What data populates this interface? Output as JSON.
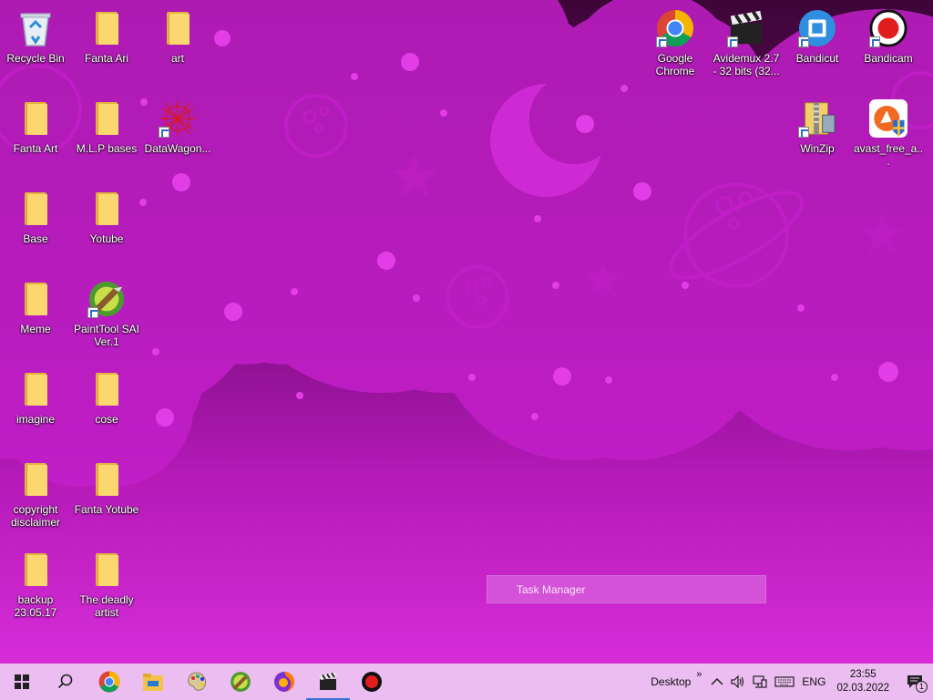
{
  "desktop_icons": {
    "recycle_bin": "Recycle Bin",
    "fanta_ari": "Fanta Ari",
    "art": "art",
    "fanta_art": "Fanta Art",
    "mlp_bases": "M.L.P bases",
    "datawagon": "DataWagon...",
    "base": "Base",
    "yotube": "Yotube",
    "meme": "Meme",
    "painttool": "PaintTool SAI Ver.1",
    "imagine": "imagine",
    "cose": "cose",
    "copyright": "copyright disclaimer",
    "fanta_yotube": "Fanta Yotube",
    "backup": "backup 23.05.17",
    "deadly_artist": "The deadly artist",
    "chrome": "Google Chrome",
    "avidemux": "Avidemux 2.7 - 32 bits (32...",
    "bandicut": "Bandicut",
    "bandicam": "Bandicam",
    "winzip": "WinZip",
    "avast": "avast_free_a..."
  },
  "overlay": {
    "task_manager": "Task Manager"
  },
  "taskbar": {
    "desktop_label": "Desktop",
    "toolbar_expand": "»",
    "language": "ENG",
    "time": "23:55",
    "date": "02.03.2022",
    "notification_count": "1"
  },
  "colors": {
    "taskbar_bg": "#ebbdf0",
    "wallpaper_top": "#3d0538",
    "wallpaper_bottom": "#d62cd8",
    "star_color": "#d12ad6",
    "folder": "#fbd770"
  }
}
